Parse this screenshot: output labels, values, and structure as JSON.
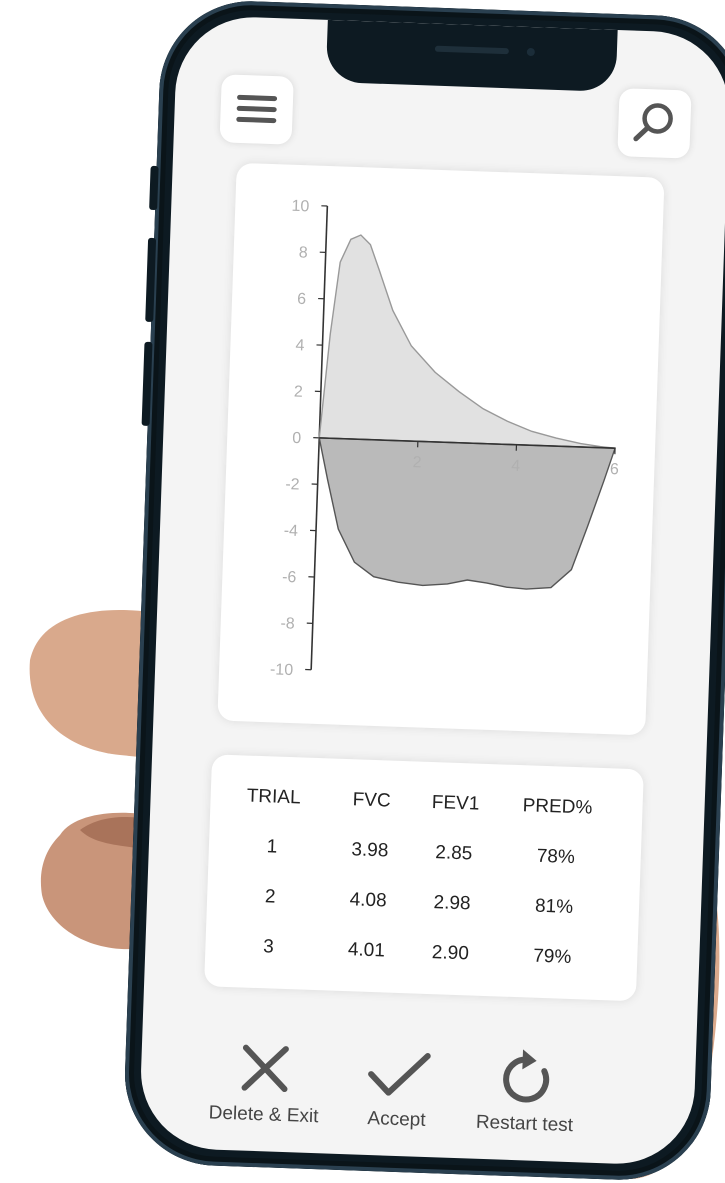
{
  "chart_data": {
    "type": "area",
    "x_ticks": [
      "2",
      "4",
      "6"
    ],
    "y_ticks": [
      "10",
      "8",
      "6",
      "4",
      "2",
      "0",
      "-2",
      "-4",
      "-6",
      "-8",
      "-10"
    ],
    "xlim": [
      0,
      6
    ],
    "ylim": [
      -10,
      10
    ],
    "series": [
      {
        "x": [
          0,
          0.15,
          0.3,
          0.5,
          0.7,
          0.9,
          1.1,
          1.4,
          1.8,
          2.3,
          2.8,
          3.3,
          3.8,
          4.3,
          4.8,
          5.3,
          5.7,
          6.0
        ],
        "values": [
          0,
          4.5,
          7.6,
          8.6,
          8.8,
          8.4,
          7.3,
          5.6,
          4.1,
          3.0,
          2.2,
          1.5,
          1.0,
          0.6,
          0.35,
          0.15,
          0.05,
          0
        ]
      },
      {
        "x": [
          0,
          0.2,
          0.45,
          0.8,
          1.2,
          1.7,
          2.2,
          2.7,
          3.1,
          3.5,
          3.9,
          4.3,
          4.8,
          5.2,
          5.5,
          5.8,
          6.0
        ],
        "values": [
          0,
          -1.8,
          -3.9,
          -5.3,
          -5.9,
          -6.1,
          -6.2,
          -6.1,
          -5.9,
          -6.0,
          -6.15,
          -6.2,
          -6.1,
          -5.3,
          -3.4,
          -1.4,
          0
        ]
      }
    ]
  },
  "table": {
    "headers": [
      "TRIAL",
      "FVC",
      "FEV1",
      "PRED%"
    ],
    "rows": [
      [
        "1",
        "3.98",
        "2.85",
        "78%"
      ],
      [
        "2",
        "4.08",
        "2.98",
        "81%"
      ],
      [
        "3",
        "4.01",
        "2.90",
        "79%"
      ]
    ]
  },
  "actions": {
    "delete": "Delete & Exit",
    "accept": "Accept",
    "restart": "Restart test"
  },
  "icons": {
    "menu": "hamburger-menu-icon",
    "search": "search-icon",
    "delete": "close-icon",
    "accept": "checkmark-icon",
    "restart": "restart-icon"
  },
  "colors": {
    "screen_bg": "#f4f4f4",
    "card_bg": "#ffffff",
    "icon_gray": "#555555",
    "phone_frame": "#0d1a22"
  }
}
